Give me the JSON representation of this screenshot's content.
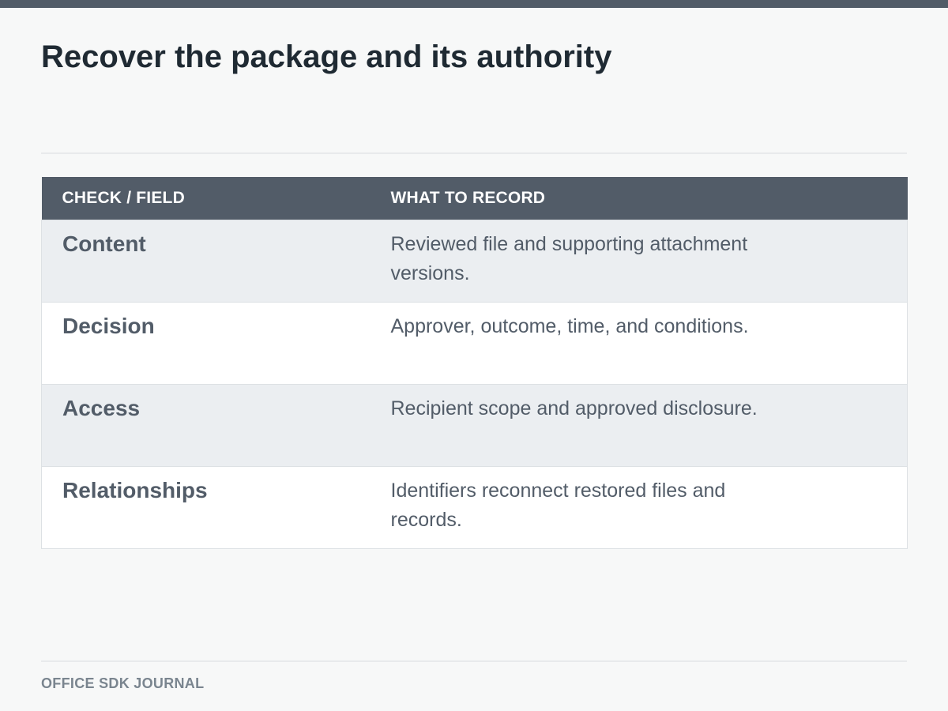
{
  "page": {
    "title": "Recover the package and its authority",
    "footer": "OFFICE SDK JOURNAL"
  },
  "table": {
    "headers": [
      "CHECK / FIELD",
      "WHAT TO RECORD"
    ],
    "rows": [
      {
        "field": "Content",
        "record": "Reviewed file and supporting attachment versions."
      },
      {
        "field": "Decision",
        "record": "Approver, outcome, time, and conditions."
      },
      {
        "field": "Access",
        "record": "Recipient scope and approved disclosure."
      },
      {
        "field": "Relationships",
        "record": "Identifiers reconnect restored files and records."
      }
    ]
  },
  "colors": {
    "header_bg": "#525c68",
    "title_text": "#1f2a33",
    "row_shaded": "#ebeef1",
    "row_plain": "#ffffff",
    "page_bg": "#f7f8f8"
  }
}
